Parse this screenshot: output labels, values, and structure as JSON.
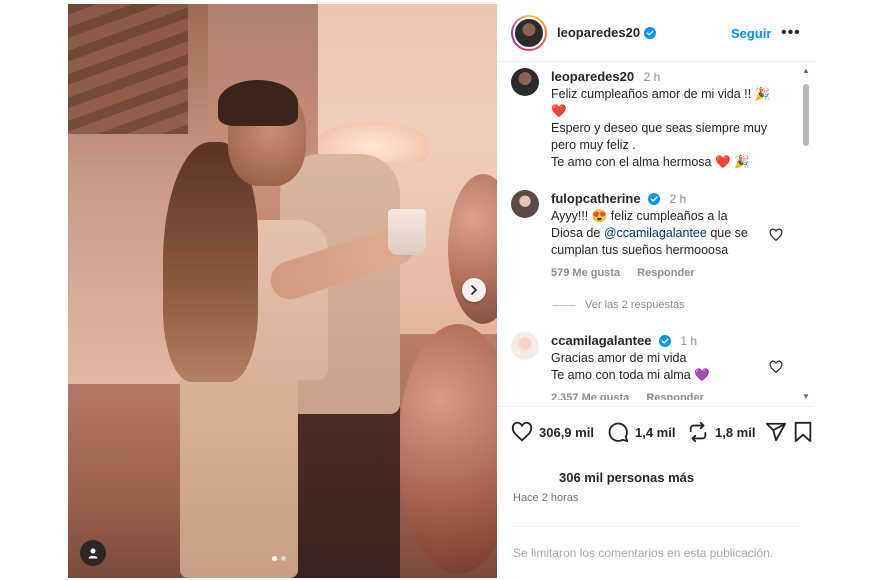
{
  "post": {
    "carousel": {
      "current_slide": 1,
      "total_slides": 2
    }
  },
  "header": {
    "username": "leoparedes20",
    "follow_label": "Seguir",
    "more_label": "•••"
  },
  "caption": {
    "username": "leoparedes20",
    "time": "2 h",
    "line1": "Feliz cumpleaños amor de mi vida !! 🎉",
    "line2": "❤️",
    "line3": "Espero y deseo que seas siempre muy",
    "line4": "pero muy feliz .",
    "line5": "Te amo con el alma hermosa ❤️ 🎉"
  },
  "comments": [
    {
      "username": "fulopcatherine",
      "time": "2 h",
      "text_before": "Ayyy!!! 😍 feliz cumpleaños a la Diosa de ",
      "mention": "@ccamilagalantee",
      "text_after": " que se cumplan tus sueños hermooosa",
      "likes": "579 Me gusta",
      "reply": "Responder",
      "view_replies": "Ver las 2 respuestas"
    },
    {
      "username": "ccamilagalantee",
      "time": "1 h",
      "line1": "Gracias amor de mi vida",
      "line2": "Te amo con toda mi alma 💜",
      "likes": "2.357 Me gusta",
      "reply": "Responder"
    }
  ],
  "actions": {
    "likes_count": "306,9 mil",
    "comments_count": "1,4 mil",
    "reposts_count": "1,8 mil"
  },
  "summary": {
    "likes_text": "306 mil personas más",
    "posted_ago": "Hace 2 horas",
    "comments_limited": "Se limitaron los comentarios en esta publicación."
  },
  "colors": {
    "accent_blue": "#0095f6",
    "verified_blue": "#0095f6",
    "text_primary": "#262626",
    "text_secondary": "#8e8e8e"
  },
  "icons": [
    "chevron-right-icon",
    "user-tag-icon",
    "verified-icon",
    "more-icon",
    "heart-icon",
    "comment-icon",
    "repost-icon",
    "share-icon",
    "bookmark-icon",
    "scroll-up-icon",
    "scroll-down-icon"
  ]
}
